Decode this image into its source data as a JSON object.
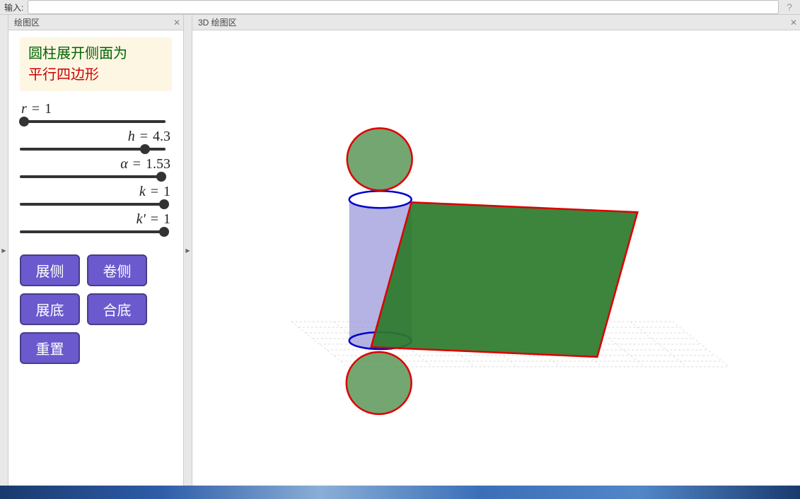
{
  "input_bar": {
    "label": "输入:",
    "value": "",
    "placeholder": ""
  },
  "panels": {
    "left_title": "绘图区",
    "right_title": "3D 绘图区"
  },
  "infobox": {
    "line1": "圆柱展开侧面为",
    "line2": "平行四边形"
  },
  "sliders": {
    "r": {
      "label_var": "r",
      "label_eq": " = ",
      "value": "1",
      "value_num": 1,
      "min": 0,
      "max": 5,
      "pos_pct": 3
    },
    "h": {
      "label_var": "h",
      "label_eq": " = ",
      "value": "4.3",
      "value_num": 4.3,
      "min": 0,
      "max": 5,
      "pos_pct": 86
    },
    "a": {
      "label_var": "α",
      "label_eq": " = ",
      "value": "1.53",
      "value_num": 1.53,
      "min": 0,
      "max": 1.6,
      "pos_pct": 97
    },
    "k": {
      "label_var": "k",
      "label_eq": " = ",
      "value": "1",
      "value_num": 1,
      "min": 0,
      "max": 1,
      "pos_pct": 99
    },
    "kp": {
      "label_var": "k'",
      "label_eq": " = ",
      "value": "1",
      "value_num": 1,
      "min": 0,
      "max": 1,
      "pos_pct": 99
    }
  },
  "buttons": {
    "b1": "展侧",
    "b2": "卷侧",
    "b3": "展底",
    "b4": "合底",
    "b5": "重置"
  },
  "chart_data": {
    "type": "3d-geometry",
    "description": "Cylinder lateral surface unfolded into parallelogram",
    "cylinder": {
      "radius": 1,
      "height": 4.3,
      "color_fill": "#9b99d9",
      "rim_color": "#0000cc"
    },
    "parallelogram": {
      "width": 6.28,
      "height": 4.3,
      "skew_angle": 1.53,
      "fill": "#2d7a2d",
      "stroke": "#dd0000"
    },
    "top_circle": {
      "radius": 1,
      "fill": "#609a5c",
      "stroke": "#dd0000",
      "flipped_up": true
    },
    "bottom_circle": {
      "radius": 1,
      "fill": "#609a5c",
      "stroke": "#dd0000",
      "flipped_down": true
    },
    "grid_plane": {
      "visible": true,
      "color": "#999"
    }
  }
}
